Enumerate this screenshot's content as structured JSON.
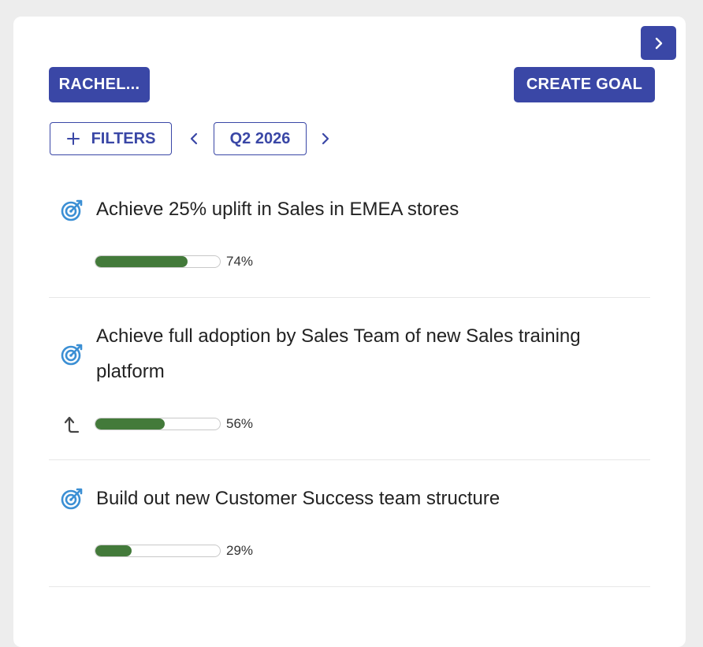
{
  "header": {
    "user_label": "RACHEL...",
    "create_label": "CREATE GOAL"
  },
  "toolbar": {
    "filters_label": "FILTERS",
    "period": "Q2 2026"
  },
  "goals": [
    {
      "title": "Achieve 25% uplift in Sales in EMEA stores",
      "progress": 0.74,
      "progress_label": "74%",
      "icon": "target-icon"
    },
    {
      "title": "Achieve full adoption by Sales Team of new Sales training platform",
      "progress": 0.56,
      "progress_label": "56%",
      "icon": "target-icon",
      "has_parent_link": true
    },
    {
      "title": "Build out new Customer Success team structure",
      "progress": 0.29,
      "progress_label": "29%",
      "icon": "target-icon"
    }
  ],
  "colors": {
    "accent": "#3a47a6",
    "progress": "#437a3a",
    "target_icon": "#3b8fd4"
  }
}
